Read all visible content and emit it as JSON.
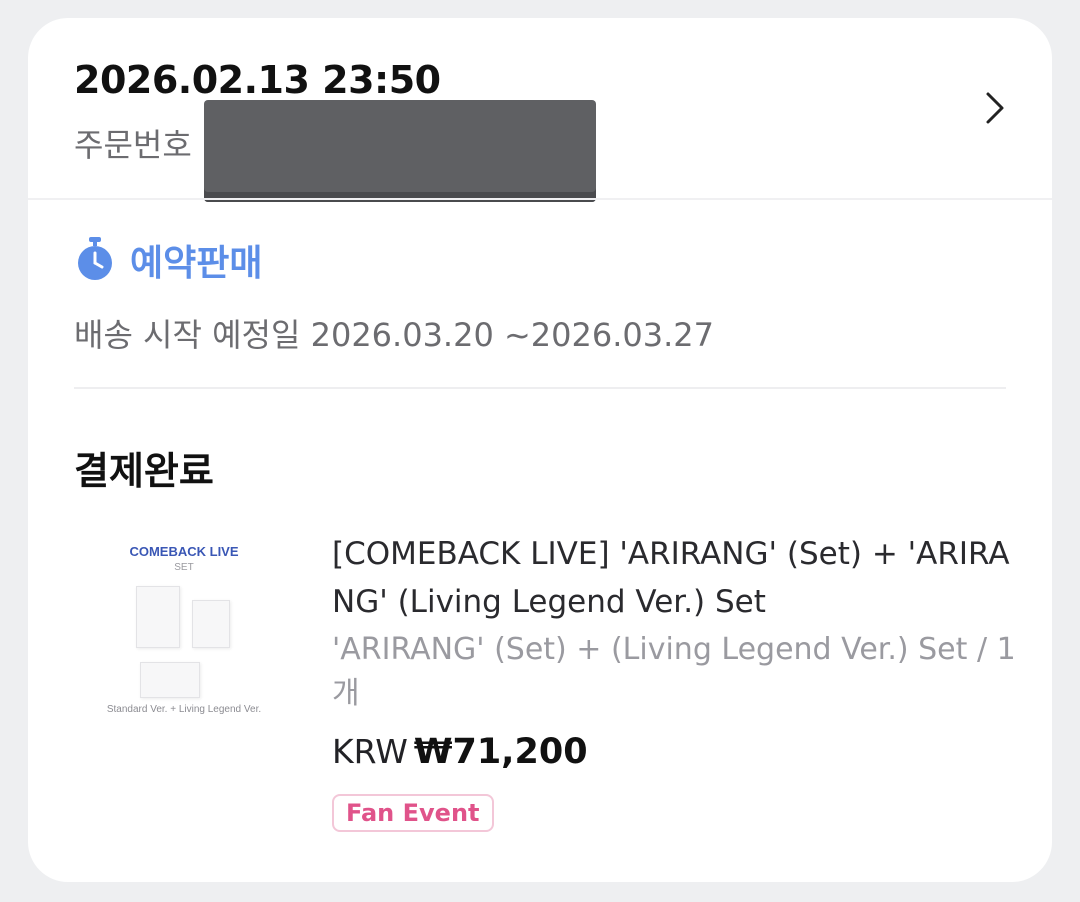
{
  "order": {
    "datetime": "2026.02.13 23:50",
    "number_label": "주문번호"
  },
  "presale": {
    "label": "예약판매",
    "shipping_text": "배송 시작 예정일 2026.03.20 ~2026.03.27"
  },
  "status": "결제완료",
  "product": {
    "thumbnail": {
      "title": "COMEBACK LIVE",
      "subtitle": "SET",
      "caption": "Standard Ver. + Living Legend Ver."
    },
    "name": "[COMEBACK LIVE] 'ARIRANG' (Set) + 'ARIRANG' (Living Legend Ver.) Set",
    "option": "'ARIRANG' (Set) + (Living Legend Ver.) Set / 1개",
    "currency": "KRW",
    "price": "₩71,200",
    "badge": "Fan Event"
  },
  "colors": {
    "accent_blue": "#5c8ee8",
    "badge_pink": "#e0538a",
    "badge_border": "#f3c7d8"
  },
  "icons": {
    "chevron": "chevron-right-icon",
    "presale": "stopwatch-icon"
  }
}
